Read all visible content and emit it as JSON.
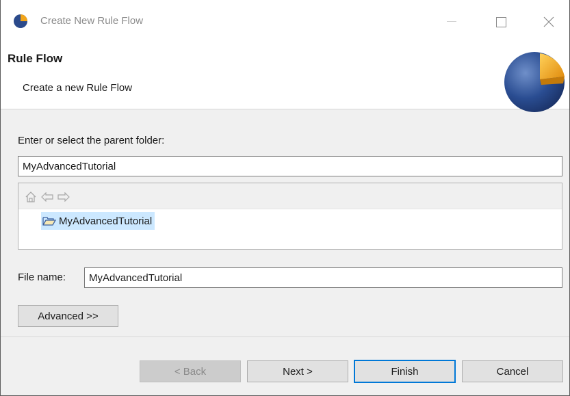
{
  "window": {
    "title": "Create New Rule Flow",
    "controls": {
      "minimize_icon": "minimize-icon",
      "maximize_icon": "maximize-icon",
      "close_icon": "close-icon"
    }
  },
  "banner": {
    "heading": "Rule Flow",
    "description": "Create a new Rule Flow"
  },
  "parent_folder": {
    "label": "Enter or select the parent folder:",
    "value": "MyAdvancedTutorial"
  },
  "tree": {
    "toolbar": [
      "home-icon",
      "back-arrow-icon",
      "forward-arrow-icon"
    ],
    "items": [
      {
        "label": "MyAdvancedTutorial",
        "selected": true,
        "icon": "open-folder-icon"
      }
    ]
  },
  "file_name": {
    "label": "File name:",
    "value": "MyAdvancedTutorial"
  },
  "advanced_button": "Advanced >>",
  "buttons": {
    "back": "< Back",
    "next": "Next >",
    "finish": "Finish",
    "cancel": "Cancel"
  },
  "colors": {
    "selection": "#cce8ff",
    "default_button_border": "#0078d7",
    "dialog_background": "#f0f0f0"
  }
}
